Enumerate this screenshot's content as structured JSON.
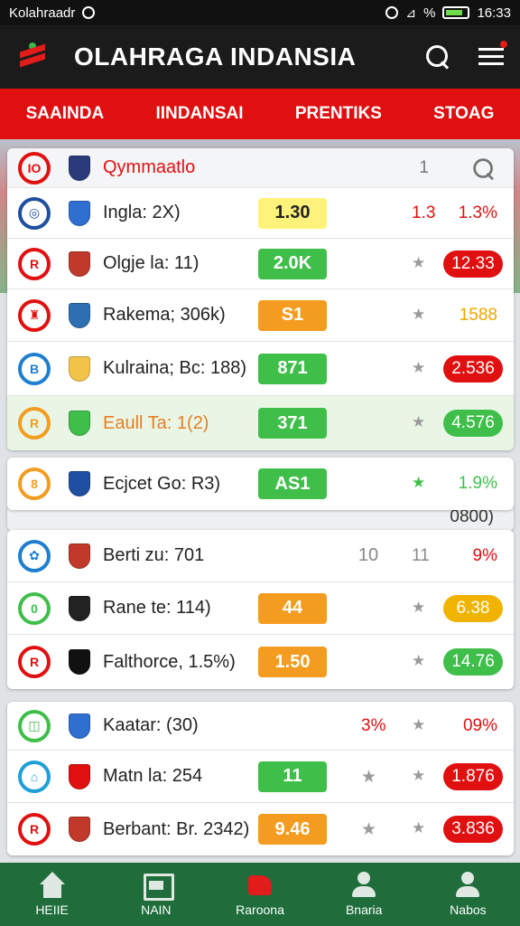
{
  "status_bar": {
    "left_text": "Kolahraadr",
    "battery_text": "%",
    "time": "16:33"
  },
  "app": {
    "title": "OLAHRAGA INDANSIA"
  },
  "tabs": [
    "SAAINDA",
    "IINDANSAI",
    "PRENTIKS",
    "STOAG"
  ],
  "groups": [
    {
      "rows": [
        {
          "circle": "IO",
          "circle_color": "#e01010",
          "crest": "#2a3b7a",
          "name": "Qymmaatlo",
          "name_color": "#e01010",
          "odds": "",
          "odds_bg": "",
          "odds_color": "",
          "star": "",
          "star_color": "",
          "pct": "1",
          "pct_bg": "",
          "pct_color": "#777",
          "extra": "search"
        },
        {
          "circle": "◎",
          "circle_color": "#1f4fa0",
          "crest": "#2f6fcf",
          "name": "Ingla: 2X)",
          "odds": "1.30",
          "odds_bg": "#fff27a",
          "odds_color": "#222",
          "star": "1.3",
          "star_color": "#e01010",
          "pct": "1.3%",
          "pct_bg": "",
          "pct_color": "#e01010"
        },
        {
          "circle": "R",
          "circle_color": "#e01010",
          "crest": "#c0392b",
          "name": "Olgje la: 11)",
          "odds": "2.0K",
          "odds_bg": "#3fbf4a",
          "odds_color": "#fff",
          "star": "★",
          "star_color": "#9a9a9a",
          "pct": "12.33",
          "pct_bg": "#e01010",
          "pct_color": "#fff"
        },
        {
          "circle": "♜",
          "circle_color": "#e01010",
          "crest": "#2d6fb0",
          "name": "Rakema; 306k)",
          "odds": "S1",
          "odds_bg": "#f39c1f",
          "odds_color": "#fff",
          "star": "★",
          "star_color": "#9a9a9a",
          "pct": "1588",
          "pct_bg": "",
          "pct_color": "#f0a500"
        },
        {
          "circle": "B",
          "circle_color": "#1e7ecf",
          "crest": "#f2c44a",
          "name": "Kulraina; Bc: 188)",
          "odds": "871",
          "odds_bg": "#3fbf4a",
          "odds_color": "#fff",
          "star": "★",
          "star_color": "#9a9a9a",
          "pct": "2.536",
          "pct_bg": "#e01010",
          "pct_color": "#fff"
        },
        {
          "circle": "R",
          "circle_color": "#f39c1f",
          "crest": "#3fbf4a",
          "name": "Eaull Ta: 1(2)",
          "name_color": "#e67e22",
          "odds": "371",
          "odds_bg": "#3fbf4a",
          "odds_color": "#fff",
          "star": "★",
          "star_color": "#9a9a9a",
          "pct": "4.576",
          "pct_bg": "#3fbf4a",
          "pct_color": "#fff",
          "highlight": true
        }
      ]
    },
    {
      "rows": [
        {
          "circle": "8",
          "circle_color": "#f39c1f",
          "crest": "#1f4fa0",
          "name": "Ecjcet Go: R3)",
          "odds": "AS1",
          "odds_bg": "#3fbf4a",
          "odds_color": "#fff",
          "star": "★",
          "star_color": "#3fbf4a",
          "pct": "1.9%",
          "pct_bg": "",
          "pct_color": "#3fbf4a"
        }
      ]
    },
    {
      "rows": [
        {
          "circle": "✿",
          "circle_color": "#1e7ecf",
          "crest": "#c0392b",
          "name": "Berti zu: 701",
          "odds": "10",
          "odds_bg": "",
          "odds_color": "#888",
          "star": "11",
          "star_color": "#888",
          "pct": "9%",
          "pct_bg": "",
          "pct_color": "#e01010"
        },
        {
          "circle": "0",
          "circle_color": "#3fbf4a",
          "crest": "#222",
          "name": "Rane te: 114)",
          "odds": "44",
          "odds_bg": "#f39c1f",
          "odds_color": "#fff",
          "star": "★",
          "star_color": "#9a9a9a",
          "pct": "6.38",
          "pct_bg": "#f0b400",
          "pct_color": "#fff"
        },
        {
          "circle": "R",
          "circle_color": "#e01010",
          "crest": "#111",
          "name": "Falthorce, 1.5%)",
          "odds": "1.50",
          "odds_bg": "#f39c1f",
          "odds_color": "#fff",
          "star": "★",
          "star_color": "#9a9a9a",
          "pct": "14.76",
          "pct_bg": "#3fbf4a",
          "pct_color": "#fff"
        }
      ]
    },
    {
      "rows": [
        {
          "circle": "◫",
          "circle_color": "#3fbf4a",
          "crest": "#2f6fcf",
          "name": "Kaatar: (30)",
          "odds": "",
          "odds_bg": "",
          "odds_color": "",
          "star": "★",
          "star_color": "#9a9a9a",
          "pct": "09%",
          "pct_bg": "",
          "pct_color": "#e01010",
          "mid": "3%",
          "mid_color": "#e01010"
        },
        {
          "circle": "⌂",
          "circle_color": "#1e9fd8",
          "crest": "#e01010",
          "name": "Matn la: 254",
          "odds": "11",
          "odds_bg": "#3fbf4a",
          "odds_color": "#fff",
          "star": "★",
          "star_color": "#9a9a9a",
          "pct": "1.876",
          "pct_bg": "#e01010",
          "pct_color": "#fff",
          "mid": "★",
          "mid_color": "#9a9a9a"
        },
        {
          "circle": "R",
          "circle_color": "#e01010",
          "crest": "#c0392b",
          "name": "Berbant: Br. 2342)",
          "odds": "9.46",
          "odds_bg": "#f39c1f",
          "odds_color": "#fff",
          "star": "★",
          "star_color": "#9a9a9a",
          "pct": "3.836",
          "pct_bg": "#e01010",
          "pct_color": "#fff",
          "mid": "★",
          "mid_color": "#9a9a9a"
        }
      ]
    }
  ],
  "partial_row": {
    "pct": "0800)"
  },
  "bottom_nav": [
    {
      "label": "HEIIE",
      "icon": "home-icon"
    },
    {
      "label": "NAIN",
      "icon": "scoreboard-icon"
    },
    {
      "label": "Raroona",
      "icon": "jersey-icon"
    },
    {
      "label": "Bnaria",
      "icon": "profile-icon"
    },
    {
      "label": "Nabos",
      "icon": "account-icon"
    }
  ]
}
